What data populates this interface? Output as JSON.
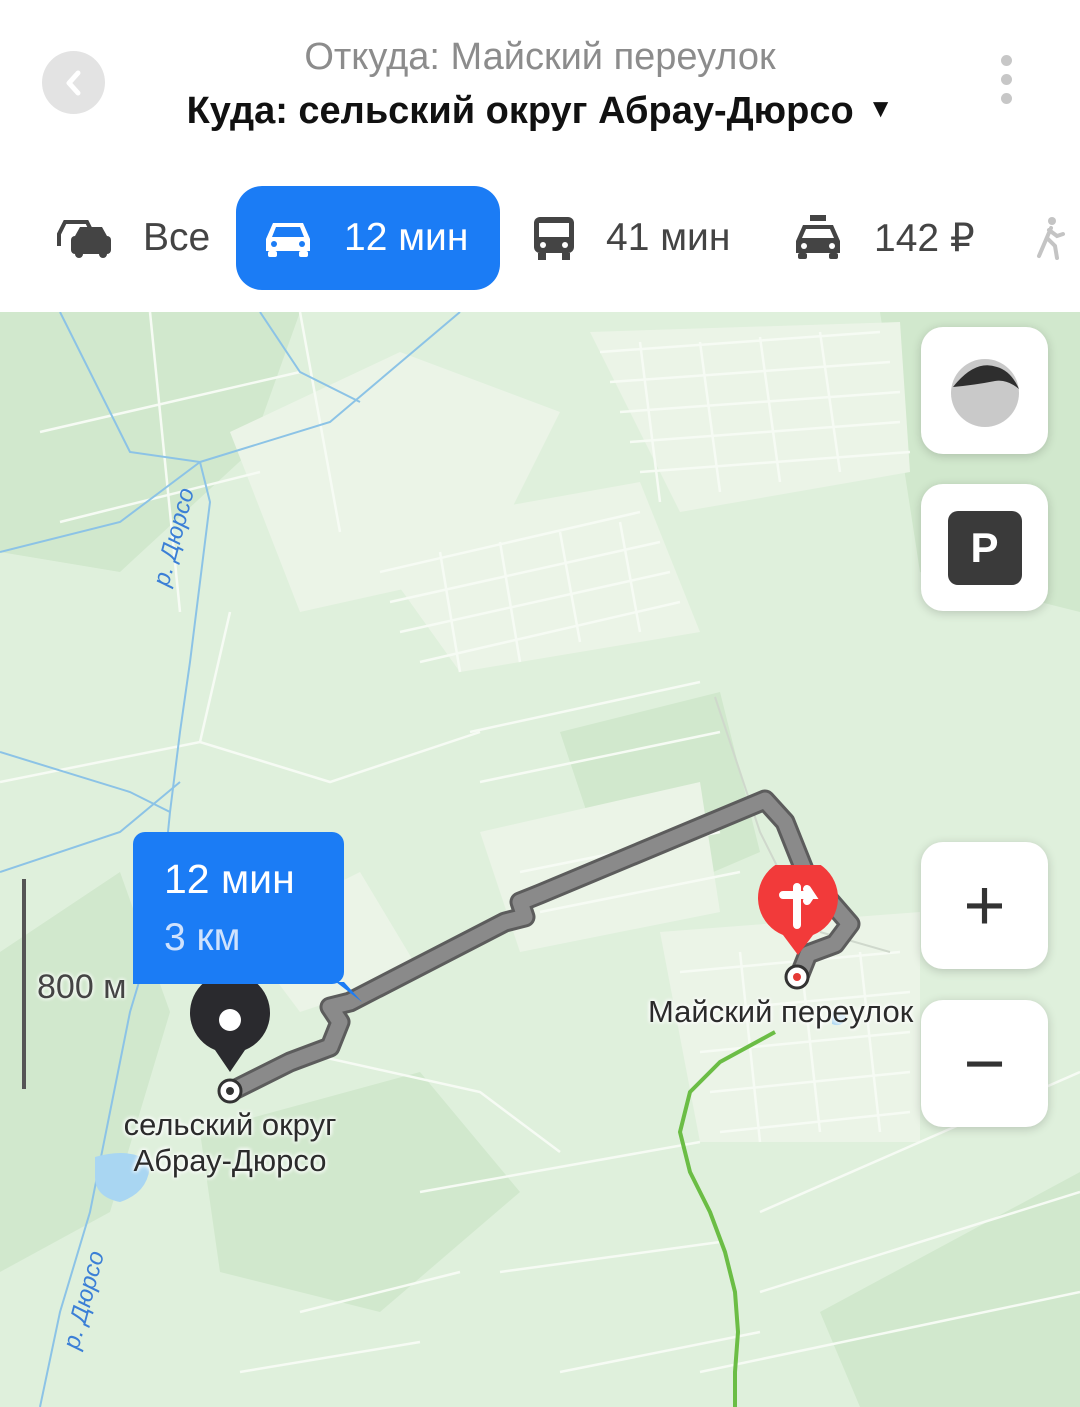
{
  "header": {
    "from_text": "Откуда: Майский переулок",
    "to_text": "Куда: сельский округ Абрау-Дюрсо",
    "to_caret": "▼"
  },
  "modes": [
    {
      "icon": "cars-icon",
      "label": "Все",
      "active": false
    },
    {
      "icon": "car-icon",
      "label": "12 мин",
      "active": true
    },
    {
      "icon": "bus-icon",
      "label": "41 мин",
      "active": false
    },
    {
      "icon": "taxi-icon",
      "label": "142 ₽",
      "active": false
    },
    {
      "icon": "pedestrian-icon",
      "label": "",
      "active": false
    }
  ],
  "map": {
    "route": {
      "time": "12 мин",
      "distance": "3 км"
    },
    "origin_label": "Майский переулок",
    "destination_label": "сельский округ Абрау-Дюрсо",
    "river_label": "р. Дюрсо",
    "river_label_2": "р. Дюрсо",
    "scale": "800 м",
    "controls": {
      "zoom_in": "+",
      "zoom_out": "−",
      "parking": "P"
    }
  },
  "colors": {
    "accent": "#1b7cf5",
    "route": "#8a8a8a",
    "origin_pin": "#f23a3a",
    "map_bg": "#dff0dc"
  }
}
